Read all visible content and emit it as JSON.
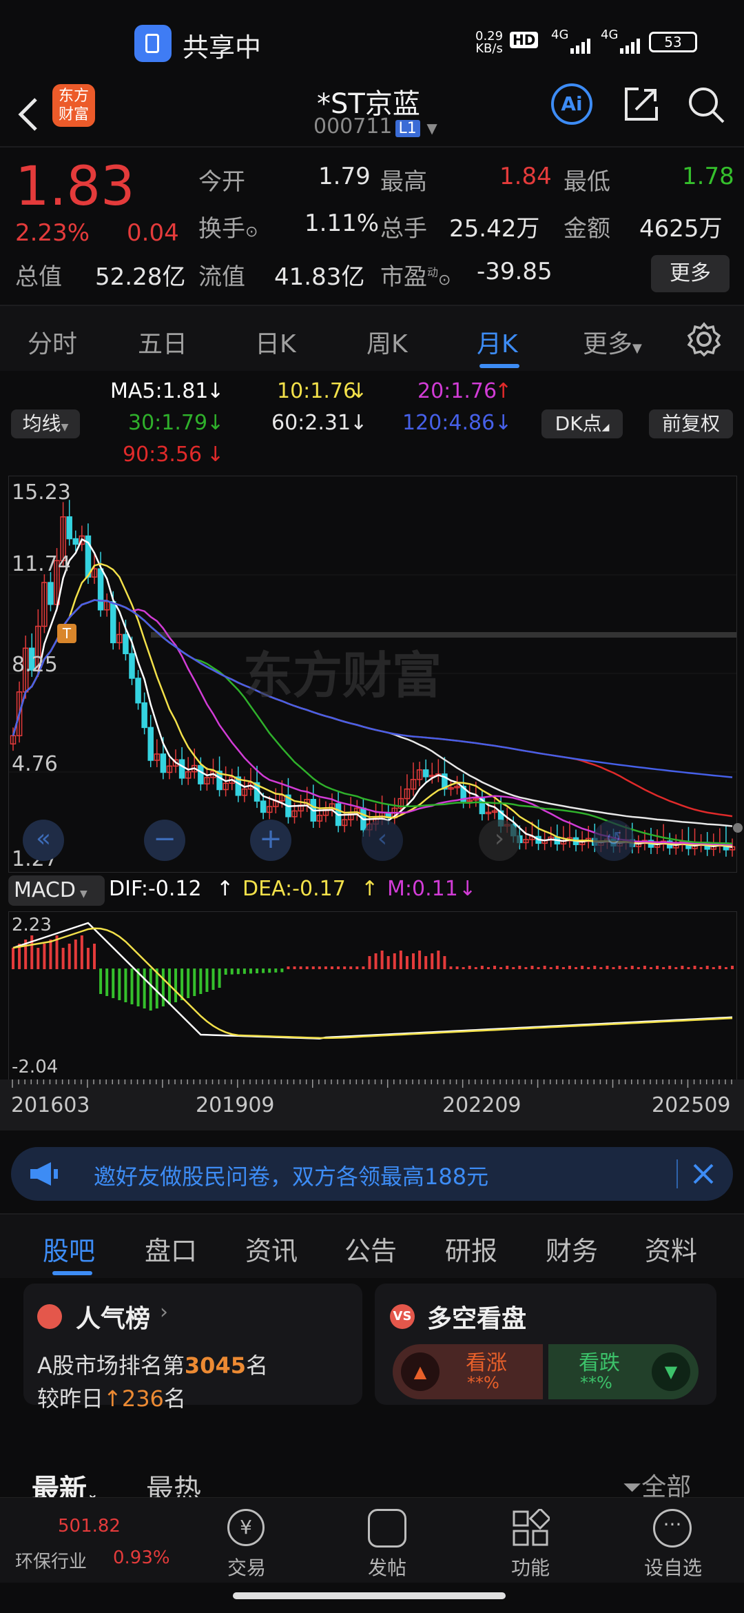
{
  "status_bar": {
    "sharing_label": "共享中",
    "net_speed_value": "0.29",
    "net_speed_unit": "KB/s",
    "hd_badge": "HD",
    "net1": "4G",
    "net2": "4G",
    "battery": "53"
  },
  "header": {
    "logo_text_top": "东方",
    "logo_text_bottom": "财富",
    "stock_name": "*ST京蓝",
    "stock_code": "000711",
    "level_badge": "L1",
    "ai_label": "Ai"
  },
  "quote": {
    "price": "1.83",
    "change_pct": "2.23%",
    "change_abs": "0.04",
    "open_label": "今开",
    "open_value": "1.79",
    "high_label": "最高",
    "high_value": "1.84",
    "low_label": "最低",
    "low_value": "1.78",
    "turnover_label": "换手",
    "turnover_value": "1.11%",
    "volume_label": "总手",
    "volume_value": "25.42万",
    "amount_label": "金额",
    "amount_value": "4625万",
    "mktcap_label": "总值",
    "mktcap_value": "52.28亿",
    "float_label": "流值",
    "float_value": "41.83亿",
    "pe_label": "市盈",
    "pe_sup": "动",
    "pe_value": "-39.85",
    "more_button": "更多"
  },
  "period_tabs": {
    "items": [
      "分时",
      "五日",
      "日K",
      "周K",
      "月K"
    ],
    "more": "更多",
    "active": "月K"
  },
  "ma_legend": {
    "mode_button": "均线",
    "ma5": "MA5:1.81",
    "ma10": "10:1.76",
    "ma20": "20:1.76",
    "ma30": "30:1.79",
    "ma60": "60:2.31",
    "ma120": "120:4.86",
    "ma90": "90:3.56",
    "dk_button": "DK点",
    "adjust_button": "前复权",
    "colors": {
      "ma5": "#ffffff",
      "ma10": "#f3e14a",
      "ma20": "#d23cd6",
      "ma30": "#2fb02b",
      "ma60": "#e8e8e8",
      "ma120": "#4660e8",
      "ma90": "#e02a2a"
    }
  },
  "kline_axis": {
    "y_ticks": [
      "15.23",
      "11.74",
      "8.25",
      "4.76",
      "1.27"
    ],
    "watermark": "东方财富",
    "marker": "T"
  },
  "macd": {
    "label": "MACD",
    "dif": "DIF:-0.12",
    "dea": "DEA:-0.17",
    "m": "M:0.11",
    "y_max": "2.23",
    "y_min": "-2.04"
  },
  "x_axis": {
    "ticks": [
      "201603",
      "201909",
      "202209",
      "202509"
    ]
  },
  "banner": {
    "text": "邀好友做股民问卷，双方各领最高188元"
  },
  "info_tabs": {
    "items": [
      "股吧",
      "盘口",
      "资讯",
      "公告",
      "研报",
      "财务",
      "资料"
    ],
    "active": "股吧"
  },
  "popularity": {
    "title": "人气榜",
    "rank_prefix": "A股市场排名第",
    "rank": "3045",
    "rank_suffix": "名",
    "change_prefix": "较昨日",
    "change_value": "236",
    "change_suffix": "名"
  },
  "bull_bear": {
    "title": "多空看盘",
    "bull_label": "看涨",
    "bull_value": "**%",
    "bear_label": "看跌",
    "bear_value": "**%"
  },
  "feed_tabs": {
    "latest": "最新",
    "hottest": "最热",
    "filter": "全部"
  },
  "bottom_nav": {
    "index_value": "501.82",
    "index_name": "环保行业",
    "index_change": "0.93%",
    "trade": "交易",
    "post": "发帖",
    "function": "功能",
    "watchlist": "设自选"
  },
  "chart_data": [
    {
      "type": "candlestick",
      "title": "",
      "x_ticks": [
        "201603",
        "201909",
        "202209",
        "202509"
      ],
      "y_ticks": [
        15.23,
        11.74,
        8.25,
        4.76,
        1.27
      ],
      "ylim": [
        1.27,
        15.23
      ],
      "series": [
        {
          "name": "MA5",
          "last": 1.81
        },
        {
          "name": "10",
          "last": 1.76
        },
        {
          "name": "20",
          "last": 1.76
        },
        {
          "name": "30",
          "last": 1.79
        },
        {
          "name": "60",
          "last": 2.31
        },
        {
          "name": "120",
          "last": 4.86
        },
        {
          "name": "90",
          "last": 3.56
        }
      ]
    },
    {
      "type": "bar",
      "title": "MACD",
      "ylim": [
        -2.04,
        2.23
      ],
      "series": [
        {
          "name": "DIF",
          "last": -0.12
        },
        {
          "name": "DEA",
          "last": -0.17
        },
        {
          "name": "M",
          "last": 0.11
        }
      ]
    }
  ]
}
